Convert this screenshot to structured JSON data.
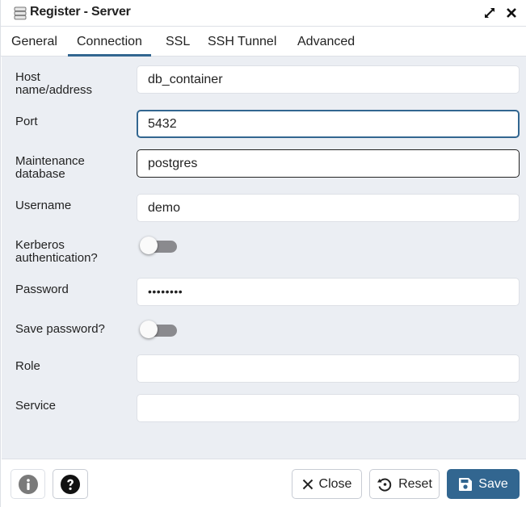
{
  "window": {
    "title": "Register - Server",
    "icons": {
      "title": "server-icon",
      "expand": "expand-icon",
      "close": "close-icon"
    }
  },
  "tabs": [
    {
      "label": "General",
      "active": false
    },
    {
      "label": "Connection",
      "active": true
    },
    {
      "label": "SSL",
      "active": false
    },
    {
      "label": "SSH Tunnel",
      "active": false
    },
    {
      "label": "Advanced",
      "active": false
    }
  ],
  "form": {
    "host": {
      "label_line1": "Host",
      "label_line2": "name/address",
      "value": "db_container"
    },
    "port": {
      "label": "Port",
      "value": "5432"
    },
    "maintenance_db": {
      "label_line1": "Maintenance",
      "label_line2": "database",
      "value": "postgres"
    },
    "username": {
      "label": "Username",
      "value": "demo"
    },
    "kerberos": {
      "label_line1": "Kerberos",
      "label_line2": "authentication?",
      "enabled": false
    },
    "password": {
      "label": "Password",
      "value": "••••••••"
    },
    "save_password": {
      "label": "Save password?",
      "enabled": false
    },
    "role": {
      "label": "Role",
      "value": ""
    },
    "service": {
      "label": "Service",
      "value": ""
    }
  },
  "footer": {
    "info_icon": "info-icon",
    "help_icon": "help-icon",
    "close_label": "Close",
    "reset_label": "Reset",
    "save_label": "Save"
  },
  "colors": {
    "accent": "#326690",
    "content_bg": "#ebeef3",
    "toggle_off": "#8a8a8e"
  }
}
